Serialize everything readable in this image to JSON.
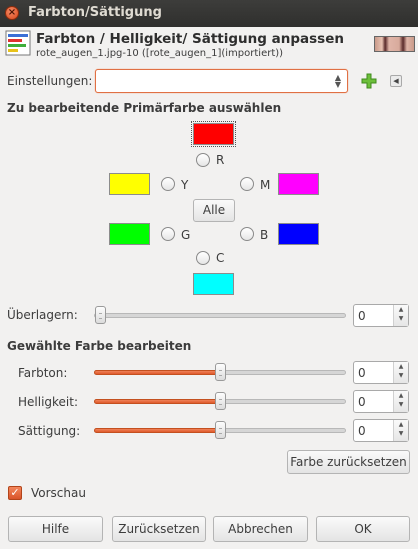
{
  "window": {
    "title": "Farbton/Sättigung"
  },
  "header": {
    "title": "Farbton / Helligkeit/ Sättigung anpassen",
    "subtitle": "rote_augen_1.jpg-10 ([rote_augen_1](importiert))",
    "thumbnail": "eyes-thumbnail"
  },
  "settings": {
    "label": "Einstellungen:",
    "value": ""
  },
  "primary": {
    "heading": "Zu bearbeitende Primärfarbe auswählen",
    "colors": {
      "R": "#ff0000",
      "Y": "#ffff00",
      "M": "#ff00ff",
      "G": "#00ff00",
      "B": "#0000ff",
      "C": "#00ffff"
    },
    "labels": {
      "R": "R",
      "Y": "Y",
      "M": "M",
      "G": "G",
      "B": "B",
      "C": "C"
    },
    "all_button": "Alle"
  },
  "overlap": {
    "label": "Überlagern:",
    "value": "0",
    "fraction": 0.0
  },
  "edit": {
    "heading": "Gewählte Farbe bearbeiten",
    "hue": {
      "label": "Farbton:",
      "value": "0",
      "fraction": 0.5
    },
    "lightness": {
      "label": "Helligkeit:",
      "value": "0",
      "fraction": 0.5
    },
    "saturation": {
      "label": "Sättigung:",
      "value": "0",
      "fraction": 0.5
    },
    "reset_color_button": "Farbe zurücksetzen"
  },
  "preview": {
    "label": "Vorschau",
    "checked": true
  },
  "buttons": {
    "help": "Hilfe",
    "reset": "Zurücksetzen",
    "cancel": "Abbrechen",
    "ok": "OK"
  },
  "accent": "#e95420"
}
